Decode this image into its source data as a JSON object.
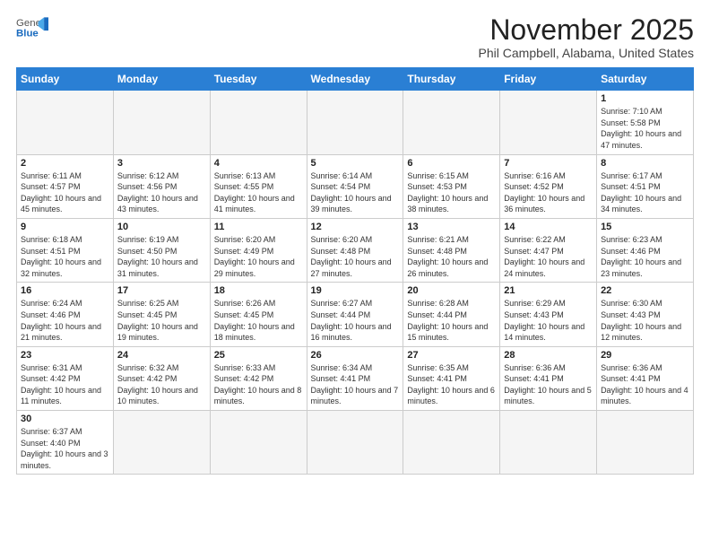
{
  "header": {
    "logo_general": "General",
    "logo_blue": "Blue",
    "month_title": "November 2025",
    "location": "Phil Campbell, Alabama, United States"
  },
  "weekdays": [
    "Sunday",
    "Monday",
    "Tuesday",
    "Wednesday",
    "Thursday",
    "Friday",
    "Saturday"
  ],
  "weeks": [
    [
      {
        "day": "",
        "info": ""
      },
      {
        "day": "",
        "info": ""
      },
      {
        "day": "",
        "info": ""
      },
      {
        "day": "",
        "info": ""
      },
      {
        "day": "",
        "info": ""
      },
      {
        "day": "",
        "info": ""
      },
      {
        "day": "1",
        "info": "Sunrise: 7:10 AM\nSunset: 5:58 PM\nDaylight: 10 hours and 47 minutes."
      }
    ],
    [
      {
        "day": "2",
        "info": "Sunrise: 6:11 AM\nSunset: 4:57 PM\nDaylight: 10 hours and 45 minutes."
      },
      {
        "day": "3",
        "info": "Sunrise: 6:12 AM\nSunset: 4:56 PM\nDaylight: 10 hours and 43 minutes."
      },
      {
        "day": "4",
        "info": "Sunrise: 6:13 AM\nSunset: 4:55 PM\nDaylight: 10 hours and 41 minutes."
      },
      {
        "day": "5",
        "info": "Sunrise: 6:14 AM\nSunset: 4:54 PM\nDaylight: 10 hours and 39 minutes."
      },
      {
        "day": "6",
        "info": "Sunrise: 6:15 AM\nSunset: 4:53 PM\nDaylight: 10 hours and 38 minutes."
      },
      {
        "day": "7",
        "info": "Sunrise: 6:16 AM\nSunset: 4:52 PM\nDaylight: 10 hours and 36 minutes."
      },
      {
        "day": "8",
        "info": "Sunrise: 6:17 AM\nSunset: 4:51 PM\nDaylight: 10 hours and 34 minutes."
      }
    ],
    [
      {
        "day": "9",
        "info": "Sunrise: 6:18 AM\nSunset: 4:51 PM\nDaylight: 10 hours and 32 minutes."
      },
      {
        "day": "10",
        "info": "Sunrise: 6:19 AM\nSunset: 4:50 PM\nDaylight: 10 hours and 31 minutes."
      },
      {
        "day": "11",
        "info": "Sunrise: 6:20 AM\nSunset: 4:49 PM\nDaylight: 10 hours and 29 minutes."
      },
      {
        "day": "12",
        "info": "Sunrise: 6:20 AM\nSunset: 4:48 PM\nDaylight: 10 hours and 27 minutes."
      },
      {
        "day": "13",
        "info": "Sunrise: 6:21 AM\nSunset: 4:48 PM\nDaylight: 10 hours and 26 minutes."
      },
      {
        "day": "14",
        "info": "Sunrise: 6:22 AM\nSunset: 4:47 PM\nDaylight: 10 hours and 24 minutes."
      },
      {
        "day": "15",
        "info": "Sunrise: 6:23 AM\nSunset: 4:46 PM\nDaylight: 10 hours and 23 minutes."
      }
    ],
    [
      {
        "day": "16",
        "info": "Sunrise: 6:24 AM\nSunset: 4:46 PM\nDaylight: 10 hours and 21 minutes."
      },
      {
        "day": "17",
        "info": "Sunrise: 6:25 AM\nSunset: 4:45 PM\nDaylight: 10 hours and 19 minutes."
      },
      {
        "day": "18",
        "info": "Sunrise: 6:26 AM\nSunset: 4:45 PM\nDaylight: 10 hours and 18 minutes."
      },
      {
        "day": "19",
        "info": "Sunrise: 6:27 AM\nSunset: 4:44 PM\nDaylight: 10 hours and 16 minutes."
      },
      {
        "day": "20",
        "info": "Sunrise: 6:28 AM\nSunset: 4:44 PM\nDaylight: 10 hours and 15 minutes."
      },
      {
        "day": "21",
        "info": "Sunrise: 6:29 AM\nSunset: 4:43 PM\nDaylight: 10 hours and 14 minutes."
      },
      {
        "day": "22",
        "info": "Sunrise: 6:30 AM\nSunset: 4:43 PM\nDaylight: 10 hours and 12 minutes."
      }
    ],
    [
      {
        "day": "23",
        "info": "Sunrise: 6:31 AM\nSunset: 4:42 PM\nDaylight: 10 hours and 11 minutes."
      },
      {
        "day": "24",
        "info": "Sunrise: 6:32 AM\nSunset: 4:42 PM\nDaylight: 10 hours and 10 minutes."
      },
      {
        "day": "25",
        "info": "Sunrise: 6:33 AM\nSunset: 4:42 PM\nDaylight: 10 hours and 8 minutes."
      },
      {
        "day": "26",
        "info": "Sunrise: 6:34 AM\nSunset: 4:41 PM\nDaylight: 10 hours and 7 minutes."
      },
      {
        "day": "27",
        "info": "Sunrise: 6:35 AM\nSunset: 4:41 PM\nDaylight: 10 hours and 6 minutes."
      },
      {
        "day": "28",
        "info": "Sunrise: 6:36 AM\nSunset: 4:41 PM\nDaylight: 10 hours and 5 minutes."
      },
      {
        "day": "29",
        "info": "Sunrise: 6:36 AM\nSunset: 4:41 PM\nDaylight: 10 hours and 4 minutes."
      }
    ],
    [
      {
        "day": "30",
        "info": "Sunrise: 6:37 AM\nSunset: 4:40 PM\nDaylight: 10 hours and 3 minutes."
      },
      {
        "day": "",
        "info": ""
      },
      {
        "day": "",
        "info": ""
      },
      {
        "day": "",
        "info": ""
      },
      {
        "day": "",
        "info": ""
      },
      {
        "day": "",
        "info": ""
      },
      {
        "day": "",
        "info": ""
      }
    ]
  ]
}
